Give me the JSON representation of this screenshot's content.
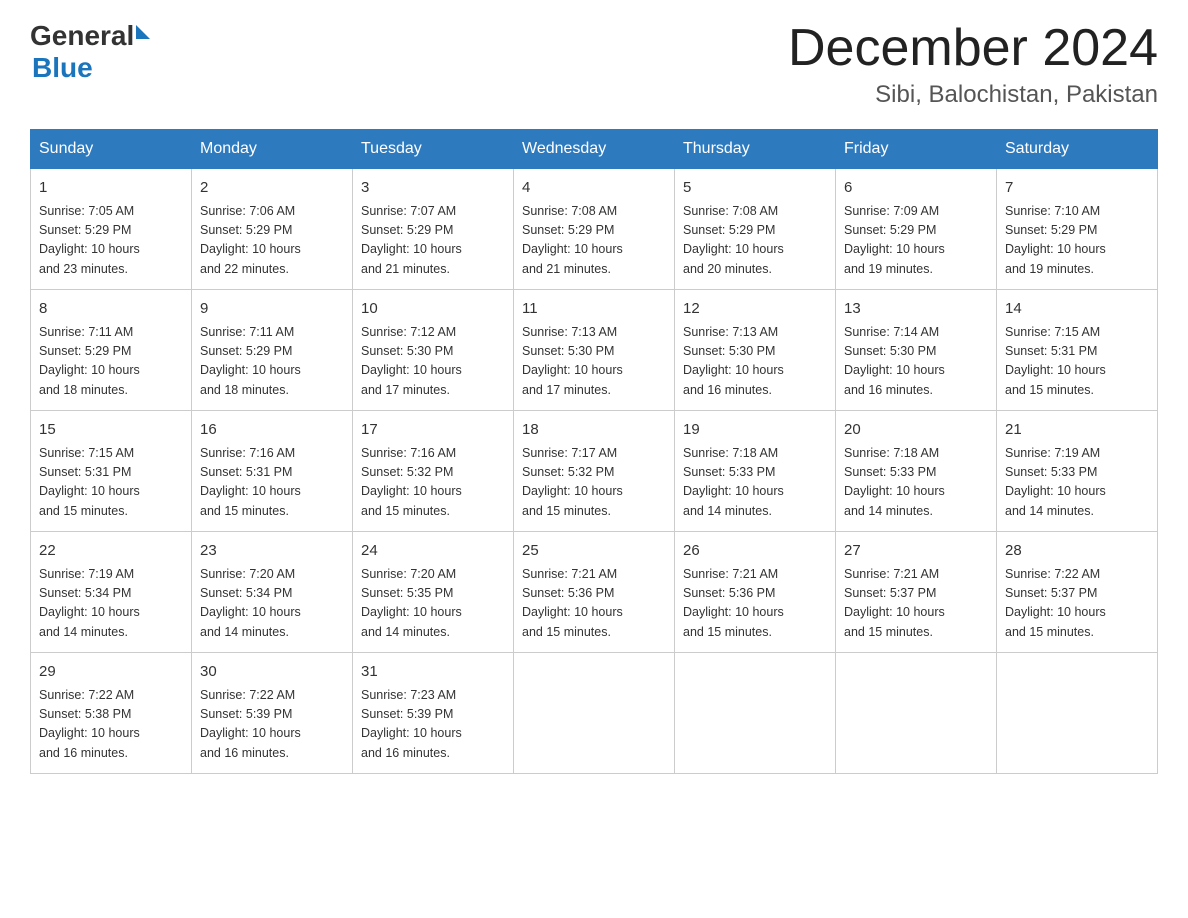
{
  "logo": {
    "text_general": "General",
    "text_blue": "Blue"
  },
  "title": "December 2024",
  "subtitle": "Sibi, Balochistan, Pakistan",
  "headers": [
    "Sunday",
    "Monday",
    "Tuesday",
    "Wednesday",
    "Thursday",
    "Friday",
    "Saturday"
  ],
  "weeks": [
    [
      {
        "day": "1",
        "sunrise": "7:05 AM",
        "sunset": "5:29 PM",
        "daylight": "10 hours and 23 minutes."
      },
      {
        "day": "2",
        "sunrise": "7:06 AM",
        "sunset": "5:29 PM",
        "daylight": "10 hours and 22 minutes."
      },
      {
        "day": "3",
        "sunrise": "7:07 AM",
        "sunset": "5:29 PM",
        "daylight": "10 hours and 21 minutes."
      },
      {
        "day": "4",
        "sunrise": "7:08 AM",
        "sunset": "5:29 PM",
        "daylight": "10 hours and 21 minutes."
      },
      {
        "day": "5",
        "sunrise": "7:08 AM",
        "sunset": "5:29 PM",
        "daylight": "10 hours and 20 minutes."
      },
      {
        "day": "6",
        "sunrise": "7:09 AM",
        "sunset": "5:29 PM",
        "daylight": "10 hours and 19 minutes."
      },
      {
        "day": "7",
        "sunrise": "7:10 AM",
        "sunset": "5:29 PM",
        "daylight": "10 hours and 19 minutes."
      }
    ],
    [
      {
        "day": "8",
        "sunrise": "7:11 AM",
        "sunset": "5:29 PM",
        "daylight": "10 hours and 18 minutes."
      },
      {
        "day": "9",
        "sunrise": "7:11 AM",
        "sunset": "5:29 PM",
        "daylight": "10 hours and 18 minutes."
      },
      {
        "day": "10",
        "sunrise": "7:12 AM",
        "sunset": "5:30 PM",
        "daylight": "10 hours and 17 minutes."
      },
      {
        "day": "11",
        "sunrise": "7:13 AM",
        "sunset": "5:30 PM",
        "daylight": "10 hours and 17 minutes."
      },
      {
        "day": "12",
        "sunrise": "7:13 AM",
        "sunset": "5:30 PM",
        "daylight": "10 hours and 16 minutes."
      },
      {
        "day": "13",
        "sunrise": "7:14 AM",
        "sunset": "5:30 PM",
        "daylight": "10 hours and 16 minutes."
      },
      {
        "day": "14",
        "sunrise": "7:15 AM",
        "sunset": "5:31 PM",
        "daylight": "10 hours and 15 minutes."
      }
    ],
    [
      {
        "day": "15",
        "sunrise": "7:15 AM",
        "sunset": "5:31 PM",
        "daylight": "10 hours and 15 minutes."
      },
      {
        "day": "16",
        "sunrise": "7:16 AM",
        "sunset": "5:31 PM",
        "daylight": "10 hours and 15 minutes."
      },
      {
        "day": "17",
        "sunrise": "7:16 AM",
        "sunset": "5:32 PM",
        "daylight": "10 hours and 15 minutes."
      },
      {
        "day": "18",
        "sunrise": "7:17 AM",
        "sunset": "5:32 PM",
        "daylight": "10 hours and 15 minutes."
      },
      {
        "day": "19",
        "sunrise": "7:18 AM",
        "sunset": "5:33 PM",
        "daylight": "10 hours and 14 minutes."
      },
      {
        "day": "20",
        "sunrise": "7:18 AM",
        "sunset": "5:33 PM",
        "daylight": "10 hours and 14 minutes."
      },
      {
        "day": "21",
        "sunrise": "7:19 AM",
        "sunset": "5:33 PM",
        "daylight": "10 hours and 14 minutes."
      }
    ],
    [
      {
        "day": "22",
        "sunrise": "7:19 AM",
        "sunset": "5:34 PM",
        "daylight": "10 hours and 14 minutes."
      },
      {
        "day": "23",
        "sunrise": "7:20 AM",
        "sunset": "5:34 PM",
        "daylight": "10 hours and 14 minutes."
      },
      {
        "day": "24",
        "sunrise": "7:20 AM",
        "sunset": "5:35 PM",
        "daylight": "10 hours and 14 minutes."
      },
      {
        "day": "25",
        "sunrise": "7:21 AM",
        "sunset": "5:36 PM",
        "daylight": "10 hours and 15 minutes."
      },
      {
        "day": "26",
        "sunrise": "7:21 AM",
        "sunset": "5:36 PM",
        "daylight": "10 hours and 15 minutes."
      },
      {
        "day": "27",
        "sunrise": "7:21 AM",
        "sunset": "5:37 PM",
        "daylight": "10 hours and 15 minutes."
      },
      {
        "day": "28",
        "sunrise": "7:22 AM",
        "sunset": "5:37 PM",
        "daylight": "10 hours and 15 minutes."
      }
    ],
    [
      {
        "day": "29",
        "sunrise": "7:22 AM",
        "sunset": "5:38 PM",
        "daylight": "10 hours and 16 minutes."
      },
      {
        "day": "30",
        "sunrise": "7:22 AM",
        "sunset": "5:39 PM",
        "daylight": "10 hours and 16 minutes."
      },
      {
        "day": "31",
        "sunrise": "7:23 AM",
        "sunset": "5:39 PM",
        "daylight": "10 hours and 16 minutes."
      },
      null,
      null,
      null,
      null
    ]
  ],
  "labels": {
    "sunrise": "Sunrise:",
    "sunset": "Sunset:",
    "daylight": "Daylight:"
  }
}
